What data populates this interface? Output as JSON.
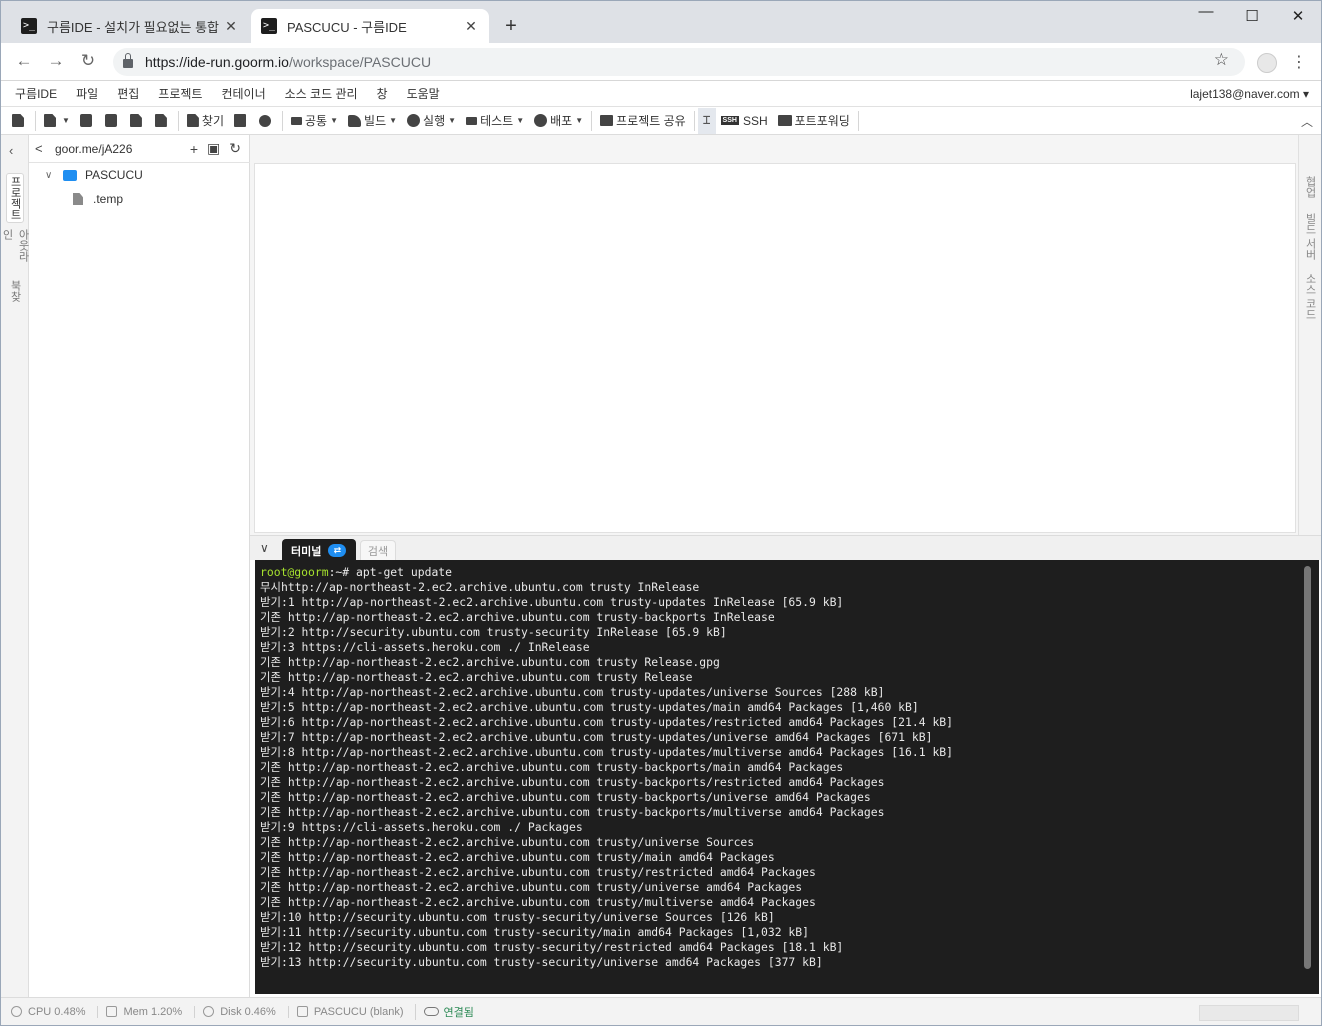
{
  "browser": {
    "tabs": [
      {
        "title": "구름IDE - 설치가 필요없는 통합",
        "active": false
      },
      {
        "title": "PASCUCU - 구름IDE",
        "active": true
      }
    ],
    "url_host": "https://ide-run.goorm.io",
    "url_path": "/workspace/PASCUCU"
  },
  "menubar": {
    "items": [
      "구름IDE",
      "파일",
      "편집",
      "프로젝트",
      "컨테이너",
      "소스 코드 관리",
      "창",
      "도움말"
    ],
    "user": "lajet138@naver.com ▾"
  },
  "toolbar": {
    "find": "찾기",
    "common": "공통",
    "build": "빌드",
    "run": "실행",
    "test": "테스트",
    "deploy": "배포",
    "share_project": "프로젝트 공유",
    "ssh": "SSH",
    "port_forwarding": "포트포워딩"
  },
  "left_rail": {
    "tabs": [
      "프로젝트",
      "아웃라인",
      "북찾"
    ]
  },
  "explorer": {
    "workspace_link": "goor.me/jA226",
    "tree": [
      {
        "type": "folder",
        "name": "PASCUCU",
        "expanded": true
      },
      {
        "type": "file",
        "name": ".temp"
      }
    ]
  },
  "right_rail": {
    "tabs": [
      "협업",
      "빌드 서버",
      "소스 코드"
    ]
  },
  "terminal": {
    "tab_label": "터미널",
    "search_tab": "검색",
    "prompt_user": "root@goorm",
    "prompt_rest": ":~# apt-get update",
    "lines": [
      "무시http://ap-northeast-2.ec2.archive.ubuntu.com trusty InRelease",
      "받기:1 http://ap-northeast-2.ec2.archive.ubuntu.com trusty-updates InRelease [65.9 kB]",
      "기존 http://ap-northeast-2.ec2.archive.ubuntu.com trusty-backports InRelease",
      "받기:2 http://security.ubuntu.com trusty-security InRelease [65.9 kB]",
      "받기:3 https://cli-assets.heroku.com ./ InRelease",
      "기존 http://ap-northeast-2.ec2.archive.ubuntu.com trusty Release.gpg",
      "기존 http://ap-northeast-2.ec2.archive.ubuntu.com trusty Release",
      "받기:4 http://ap-northeast-2.ec2.archive.ubuntu.com trusty-updates/universe Sources [288 kB]",
      "받기:5 http://ap-northeast-2.ec2.archive.ubuntu.com trusty-updates/main amd64 Packages [1,460 kB]",
      "받기:6 http://ap-northeast-2.ec2.archive.ubuntu.com trusty-updates/restricted amd64 Packages [21.4 kB]",
      "받기:7 http://ap-northeast-2.ec2.archive.ubuntu.com trusty-updates/universe amd64 Packages [671 kB]",
      "받기:8 http://ap-northeast-2.ec2.archive.ubuntu.com trusty-updates/multiverse amd64 Packages [16.1 kB]",
      "기존 http://ap-northeast-2.ec2.archive.ubuntu.com trusty-backports/main amd64 Packages",
      "기존 http://ap-northeast-2.ec2.archive.ubuntu.com trusty-backports/restricted amd64 Packages",
      "기존 http://ap-northeast-2.ec2.archive.ubuntu.com trusty-backports/universe amd64 Packages",
      "기존 http://ap-northeast-2.ec2.archive.ubuntu.com trusty-backports/multiverse amd64 Packages",
      "받기:9 https://cli-assets.heroku.com ./ Packages",
      "기존 http://ap-northeast-2.ec2.archive.ubuntu.com trusty/universe Sources",
      "기존 http://ap-northeast-2.ec2.archive.ubuntu.com trusty/main amd64 Packages",
      "기존 http://ap-northeast-2.ec2.archive.ubuntu.com trusty/restricted amd64 Packages",
      "기존 http://ap-northeast-2.ec2.archive.ubuntu.com trusty/universe amd64 Packages",
      "기존 http://ap-northeast-2.ec2.archive.ubuntu.com trusty/multiverse amd64 Packages",
      "받기:10 http://security.ubuntu.com trusty-security/universe Sources [126 kB]",
      "받기:11 http://security.ubuntu.com trusty-security/main amd64 Packages [1,032 kB]",
      "받기:12 http://security.ubuntu.com trusty-security/restricted amd64 Packages [18.1 kB]",
      "받기:13 http://security.ubuntu.com trusty-security/universe amd64 Packages [377 kB]"
    ]
  },
  "statusbar": {
    "cpu": "CPU 0.48%",
    "mem": "Mem 1.20%",
    "disk": "Disk 0.46%",
    "project": "PASCUCU (blank)",
    "connection": "연결됨"
  },
  "colors": {
    "accent": "#1f8ef1",
    "terminal_bg": "#1e1e1e",
    "prompt_user": "#a6e22e",
    "connected": "#2e8b57"
  }
}
